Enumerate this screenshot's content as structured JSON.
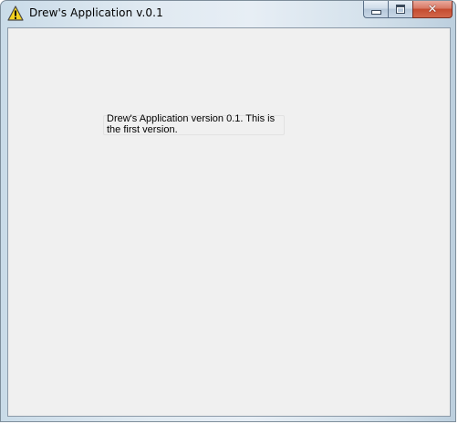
{
  "window": {
    "title": "Drew's Application v.0.1",
    "icon": "warning-triangle-icon",
    "caption_buttons": {
      "minimize": "minimize-icon",
      "maximize": "maximize-icon",
      "close": "close-icon",
      "close_glyph": "✕"
    }
  },
  "main": {
    "message": "Drew's Application version 0.1. This is the first version."
  },
  "colors": {
    "client_background": "#f0f0f0",
    "close_button": "#c44b2f",
    "warning_icon": "#f4d21f"
  }
}
